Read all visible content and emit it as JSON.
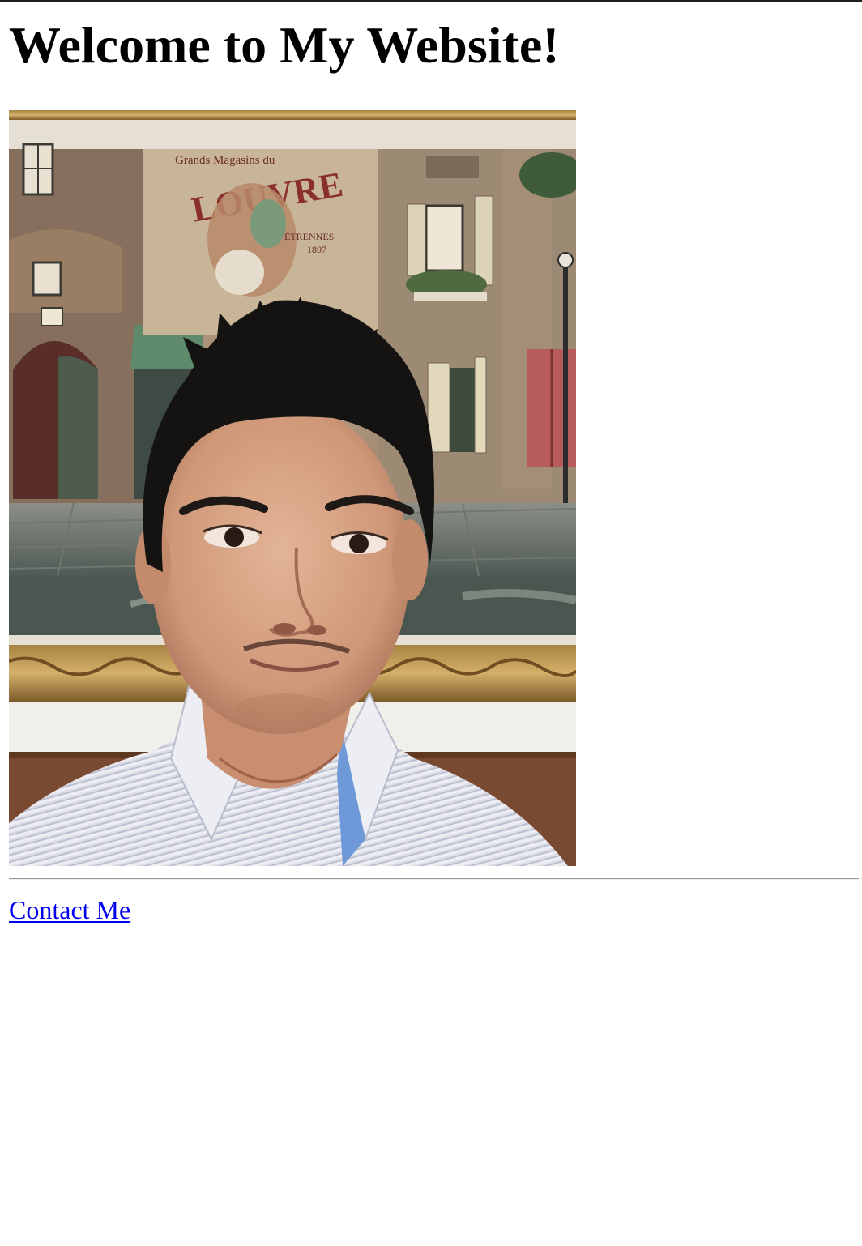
{
  "page": {
    "title": "Welcome to My Website!",
    "contact_link": "Contact Me"
  },
  "photo": {
    "alt": "Selfie in front of a framed painting of a Paris street",
    "painting_text_line1": "Grands Magasins du",
    "painting_text_line2": "LOUVRE",
    "painting_text_line3": "ÉTRENNES",
    "painting_text_line4": "1897"
  },
  "colors": {
    "link": "#0000ee",
    "text": "#000000",
    "background": "#ffffff",
    "rule": "#9a9a9a"
  }
}
